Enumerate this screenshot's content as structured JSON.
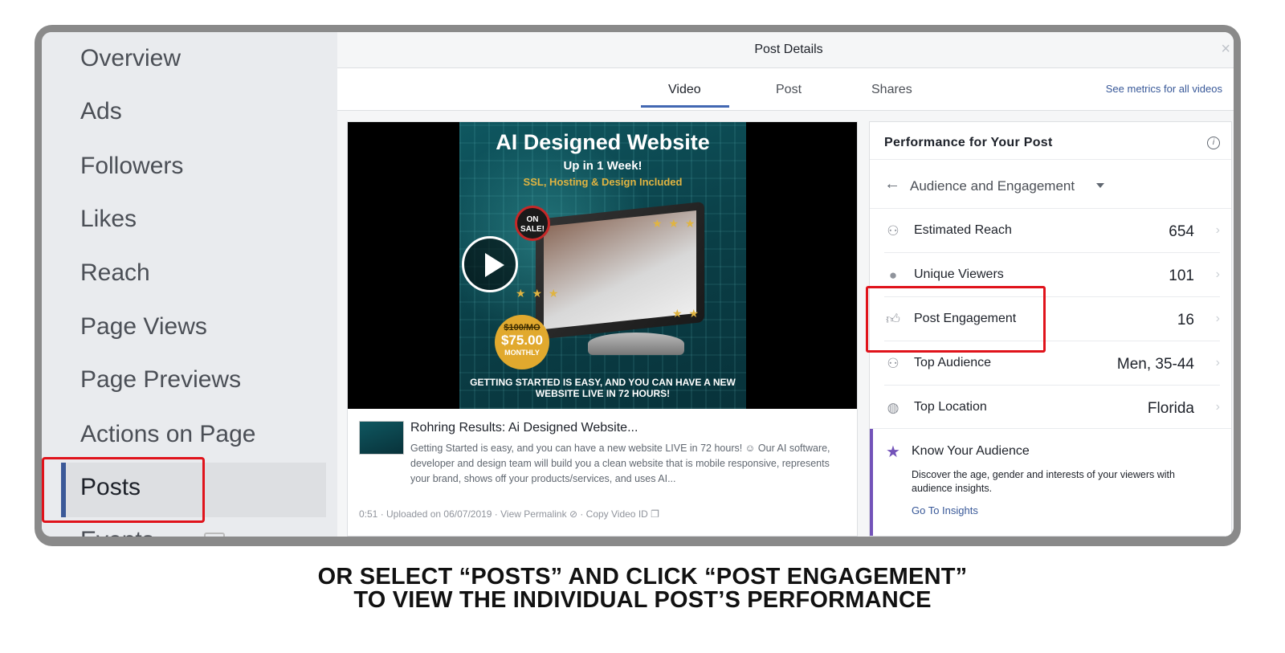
{
  "sidebar": {
    "items": [
      {
        "label": "Overview"
      },
      {
        "label": "Ads"
      },
      {
        "label": "Followers"
      },
      {
        "label": "Likes"
      },
      {
        "label": "Reach"
      },
      {
        "label": "Page Views"
      },
      {
        "label": "Page Previews"
      },
      {
        "label": "Actions on Page"
      },
      {
        "label": "Posts"
      }
    ],
    "active": "Posts",
    "partial_label": "Events"
  },
  "modal": {
    "title": "Post Details",
    "close": "×",
    "tabs": [
      {
        "label": "Video"
      },
      {
        "label": "Post"
      },
      {
        "label": "Shares"
      }
    ],
    "active_tab": "Video",
    "metrics_link": "See metrics for all videos"
  },
  "video": {
    "thumb": {
      "title": "AI Designed Website",
      "sub1": "Up in 1 Week!",
      "sub2": "SSL, Hosting & Design Included",
      "badge": "ON SALE!",
      "price_old": "$100/MO",
      "price_new": "$75.00",
      "price_period": "MONTHLY",
      "bottom": "GETTING STARTED IS EASY, AND YOU CAN HAVE A NEW WEBSITE LIVE IN 72 HOURS!"
    },
    "title": "Rohring Results: Ai Designed Website...",
    "description": "Getting Started is easy, and you can have a new website LIVE in 72 hours! ☺ Our AI software, developer and design team will build you a clean website that is mobile responsive, represents your brand, shows off your products/services, and uses AI...",
    "meta": "0:51 · Uploaded on 06/07/2019 · View Permalink ⊘ · Copy Video ID ❐"
  },
  "performance": {
    "title": "Performance for Your Post",
    "info_icon": "i",
    "back_icon": "←",
    "dropdown_label": "Audience and Engagement",
    "metrics": [
      {
        "label": "Estimated Reach",
        "value": "654",
        "icon": "people-icon"
      },
      {
        "label": "Unique Viewers",
        "value": "101",
        "icon": "person-icon"
      },
      {
        "label": "Post Engagement",
        "value": "16",
        "icon": "thumbs-up-icon"
      },
      {
        "label": "Top Audience",
        "value": "Men, 35-44",
        "icon": "group-icon"
      },
      {
        "label": "Top Location",
        "value": "Florida",
        "icon": "globe-icon"
      }
    ],
    "know_audience": {
      "title": "Know Your Audience",
      "description": "Discover the age, gender and interests of your viewers with audience insights.",
      "link": "Go To Insights"
    }
  },
  "caption": {
    "line1": "OR SELECT “POSTS” AND CLICK “POST ENGAGEMENT”",
    "line2": "TO VIEW THE INDIVIDUAL POST’S PERFORMANCE"
  },
  "colors": {
    "accent": "#4267b2",
    "highlight": "#e0131b",
    "link": "#385898",
    "audience_accent": "#7353b9"
  }
}
